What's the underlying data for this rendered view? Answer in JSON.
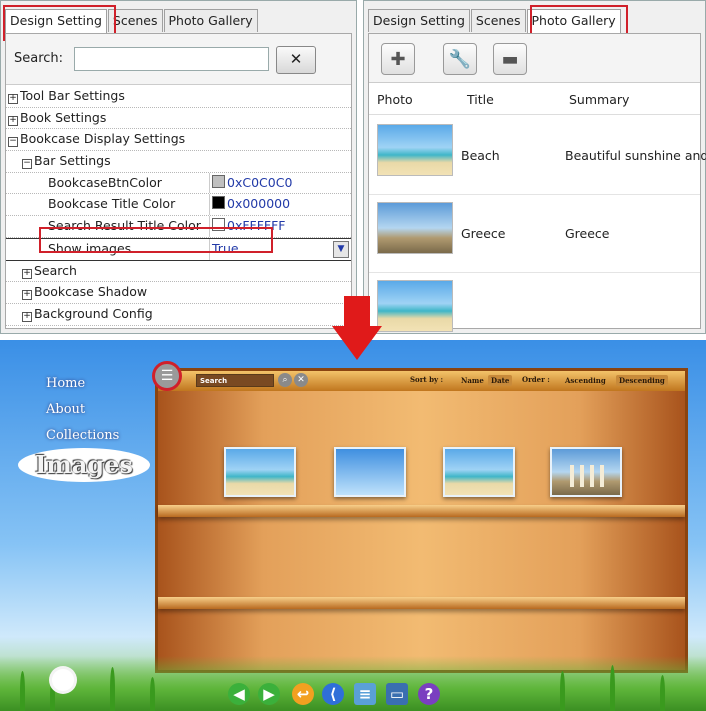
{
  "left_panel": {
    "tabs": [
      "Design Setting",
      "Scenes",
      "Photo Gallery"
    ],
    "active_tab": "Design Setting",
    "search_label": "Search:",
    "search_value": "",
    "clear_icon": "clear-x-icon",
    "properties": [
      {
        "label": "Tool Bar Settings",
        "expander": "⊞",
        "indent": 0,
        "value": ""
      },
      {
        "label": "Book Settings",
        "expander": "⊞",
        "indent": 0,
        "value": ""
      },
      {
        "label": "Bookcase Display Settings",
        "expander": "⊟",
        "indent": 0,
        "value": ""
      },
      {
        "label": "Bar Settings",
        "expander": "⊟",
        "indent": 1,
        "value": ""
      },
      {
        "label": "BookcaseBtnColor",
        "expander": "",
        "indent": 2,
        "value": "0xC0C0C0",
        "swatch": "#C0C0C0"
      },
      {
        "label": "Bookcase Title Color",
        "expander": "",
        "indent": 2,
        "value": "0x000000",
        "swatch": "#000000"
      },
      {
        "label": "Search Result Title Color",
        "expander": "",
        "indent": 2,
        "value": "0xFFFFFF",
        "swatch": "#FFFFFF"
      },
      {
        "label": "Show images",
        "expander": "",
        "indent": 2,
        "value": "True",
        "dropdown": true
      },
      {
        "label": "Search",
        "expander": "⊞",
        "indent": 1,
        "value": ""
      },
      {
        "label": "Bookcase Shadow",
        "expander": "⊞",
        "indent": 1,
        "value": ""
      },
      {
        "label": "Background Config",
        "expander": "⊞",
        "indent": 1,
        "value": ""
      }
    ]
  },
  "right_panel": {
    "tabs": [
      "Design Setting",
      "Scenes",
      "Photo Gallery"
    ],
    "active_tab": "Photo Gallery",
    "toolbar_icons": [
      "add-icon",
      "wrench-icon",
      "remove-icon"
    ],
    "columns": [
      "Photo",
      "Title",
      "Summary"
    ],
    "rows": [
      {
        "title": "Beach",
        "summary": "Beautiful sunshine and",
        "thumb": "beach"
      },
      {
        "title": "Greece",
        "summary": "Greece",
        "thumb": "greece"
      },
      {
        "title": "",
        "summary": "",
        "thumb": "beach"
      }
    ]
  },
  "preview": {
    "nav": [
      "Home",
      "About",
      "Collections",
      "Images"
    ],
    "active_nav": "Images",
    "search_placeholder": "Search",
    "sort_by_label": "Sort by :",
    "sort_options": [
      "Name",
      "Date"
    ],
    "sort_selected": "Date",
    "order_label": "Order :",
    "order_options": [
      "Ascending",
      "Descending"
    ],
    "order_selected": "Descending",
    "accent": "#d0202a"
  }
}
